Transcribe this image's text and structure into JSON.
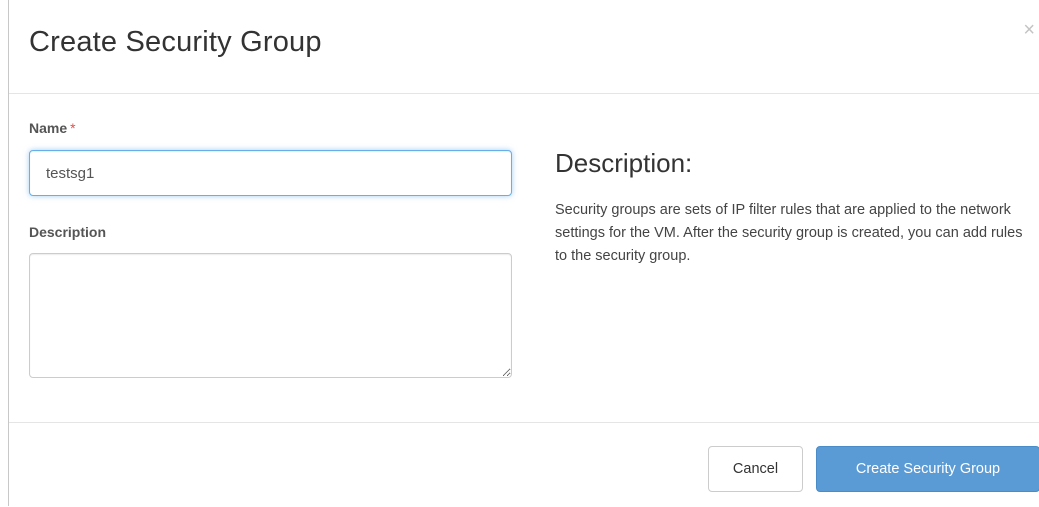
{
  "dialog": {
    "title": "Create Security Group",
    "close_glyph": "×"
  },
  "form": {
    "name_label": "Name",
    "required_marker": "*",
    "name_value": "testsg1",
    "description_label": "Description",
    "description_value": ""
  },
  "help": {
    "heading": "Description:",
    "text": "Security groups are sets of IP filter rules that are applied to the network settings for the VM. After the security group is created, you can add rules to the security group."
  },
  "footer": {
    "cancel_label": "Cancel",
    "create_label": "Create Security Group"
  },
  "colors": {
    "primary_button": "#5b9bd5",
    "focus_border": "#66afe9",
    "required_marker": "#d9534f"
  }
}
